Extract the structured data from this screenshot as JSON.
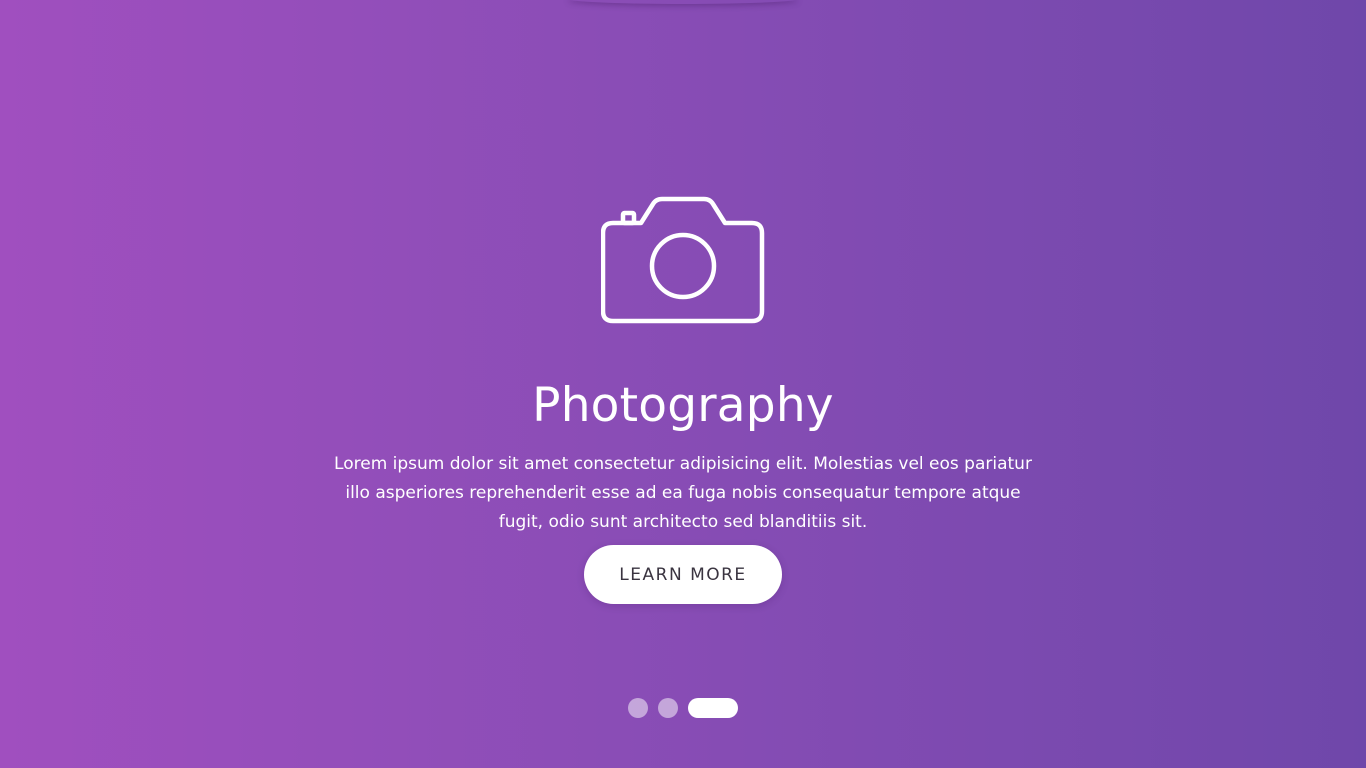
{
  "slide": {
    "icon": "camera-icon",
    "title": "Photography",
    "description": "Lorem ipsum dolor sit amet consectetur adipisicing elit. Molestias vel eos pariatur illo asperiores reprehenderit esse ad ea fuga nobis consequatur tempore atque fugit, odio sunt architecto sed blanditiis sit.",
    "button_label": "LEARN MORE"
  },
  "pagination": {
    "total": 3,
    "active_index": 3
  },
  "colors": {
    "gradient_start": "#a04fbf",
    "gradient_end": "#6f47aa",
    "button_bg": "#ffffff",
    "button_text": "#3a3440"
  }
}
